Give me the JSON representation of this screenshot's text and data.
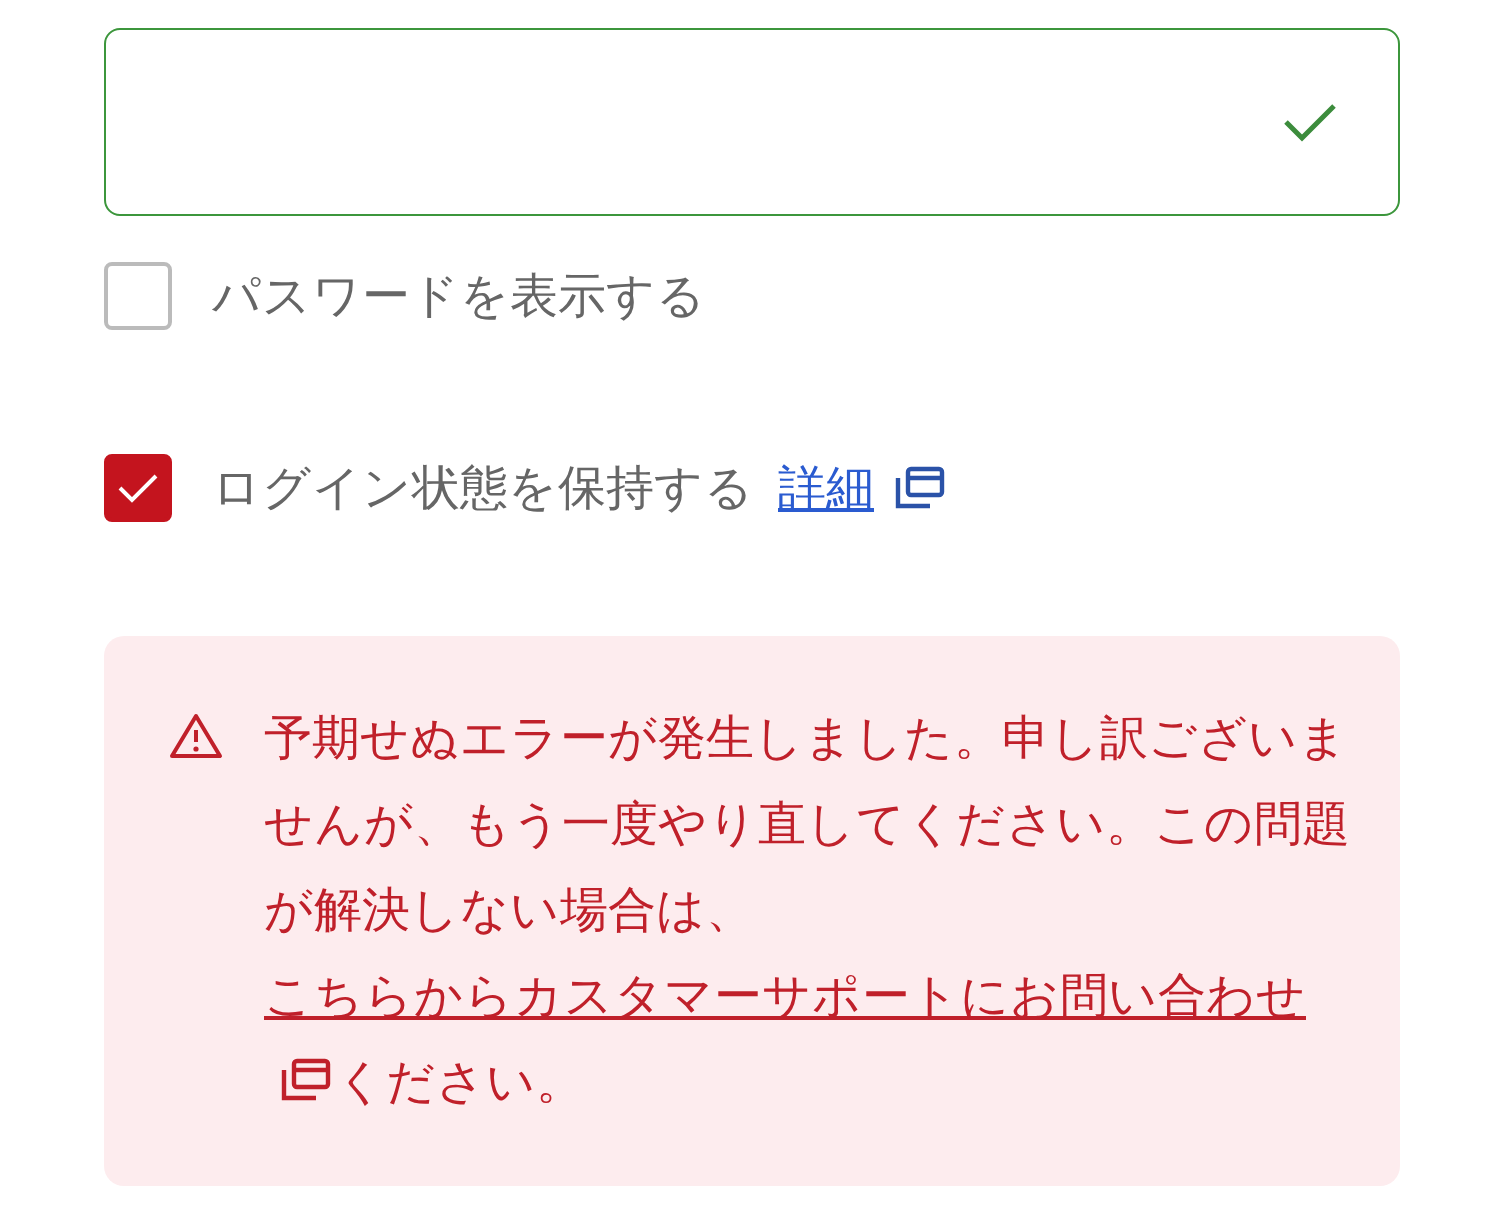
{
  "password_field": {
    "valid": true
  },
  "options": [
    {
      "label": "パスワードを表示する",
      "checked": false
    },
    {
      "label": "ログイン状態を保持する",
      "checked": true,
      "link": "詳細"
    }
  ],
  "error": {
    "text": "予期せぬエラーが発生しました。申し訳ございませんが、もう一度やり直してください。この問題が解決しない場合は、",
    "link": "こちらからカスタマーサポートにお問い合わせ",
    "after": "ください。"
  }
}
